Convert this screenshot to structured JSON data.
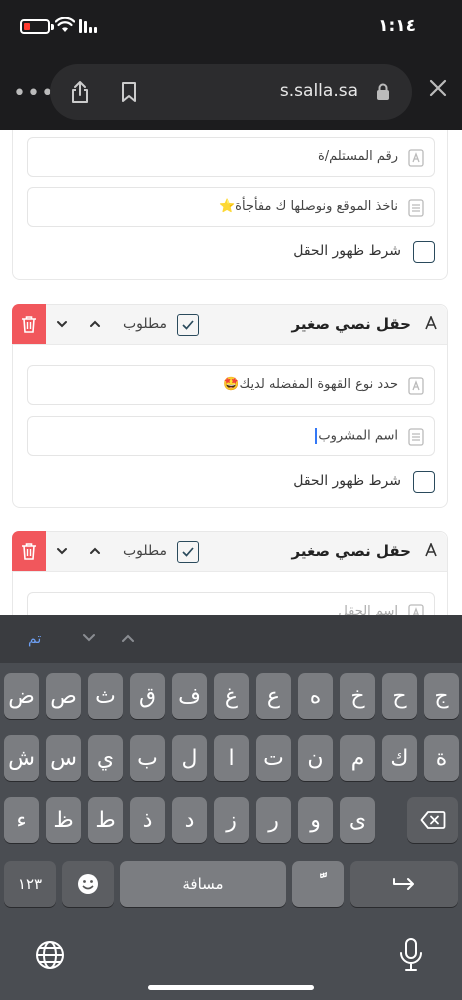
{
  "status_bar": {
    "time": "١:١٤"
  },
  "browser": {
    "url": "s.salla.sa"
  },
  "card1": {
    "field_recipient_number": "رقم المستلم/ة",
    "field_note": "ناخذ الموقع ونوصلها ك مفأجأة⭐️",
    "condition_label": "شرط ظهور الحقل"
  },
  "card2": {
    "title": "حقل نصي صغير",
    "required_label": "مطلوب",
    "field_prompt": "حدد نوع القهوة المفضله لديك🤩",
    "field_name_value": "اسم المشروب",
    "condition_label": "شرط ظهور الحقل"
  },
  "card3": {
    "title": "حقل نصي صغير",
    "required_label": "مطلوب",
    "field_placeholder": "اسم الحقل"
  },
  "keyboard": {
    "done_label": "تم",
    "row1": [
      "ض",
      "ص",
      "ث",
      "ق",
      "ف",
      "غ",
      "ع",
      "ه",
      "خ",
      "ح",
      "ج"
    ],
    "row2": [
      "ش",
      "س",
      "ي",
      "ب",
      "ل",
      "ا",
      "ت",
      "ن",
      "م",
      "ك",
      "ة"
    ],
    "row3": [
      "ء",
      "ظ",
      "ط",
      "ذ",
      "د",
      "ز",
      "ر",
      "و",
      "ى"
    ],
    "numbers_label": "١٢٣",
    "space_label": "مسافة",
    "diacritic_label": "ًّ"
  },
  "colors": {
    "delete_red": "#f1575c",
    "checkbox_border": "#2a4a5c",
    "keyboard_bg": "#4a4d52",
    "key_bg": "#7b7d81",
    "done_blue": "#6d9ff2"
  },
  "icons": {
    "status": [
      "battery-low-icon",
      "wifi-icon",
      "signal-icon"
    ],
    "browser": [
      "more-icon",
      "share-icon",
      "bookmark-icon",
      "lock-icon",
      "close-icon"
    ],
    "card": [
      "trash-icon",
      "chevron-down-icon",
      "chevron-up-icon",
      "checkmark-icon",
      "text-field-icon",
      "document-icon"
    ],
    "keyboard": [
      "emoji-icon",
      "return-icon",
      "backspace-icon",
      "globe-icon",
      "microphone-icon"
    ]
  }
}
